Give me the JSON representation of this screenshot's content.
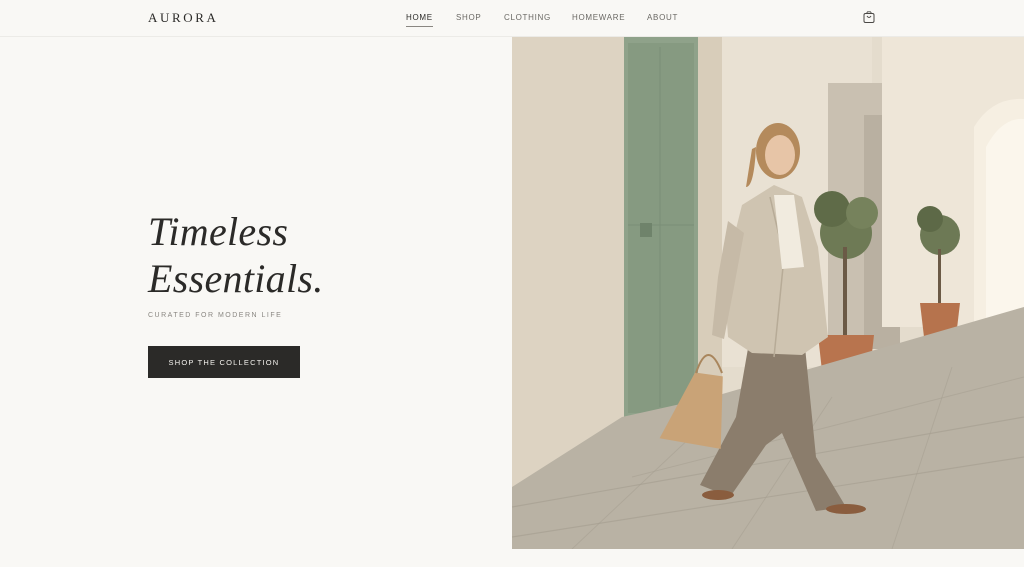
{
  "header": {
    "logo": "AURORA",
    "nav": [
      {
        "label": "HOME",
        "active": true
      },
      {
        "label": "SHOP",
        "active": false
      },
      {
        "label": "CLOTHING",
        "active": false
      },
      {
        "label": "HOMEWARE",
        "active": false
      },
      {
        "label": "ABOUT",
        "active": false
      }
    ],
    "cart_icon": "shopping-bag-icon"
  },
  "hero": {
    "headline_line1": "Timeless",
    "headline_line2": "Essentials.",
    "tagline": "CURATED FOR MODERN LIFE",
    "cta_label": "SHOP THE COLLECTION"
  },
  "colors": {
    "background": "#f9f8f5",
    "text": "#2b2a28",
    "button": "#2b2a28",
    "muted": "#8a8782"
  }
}
